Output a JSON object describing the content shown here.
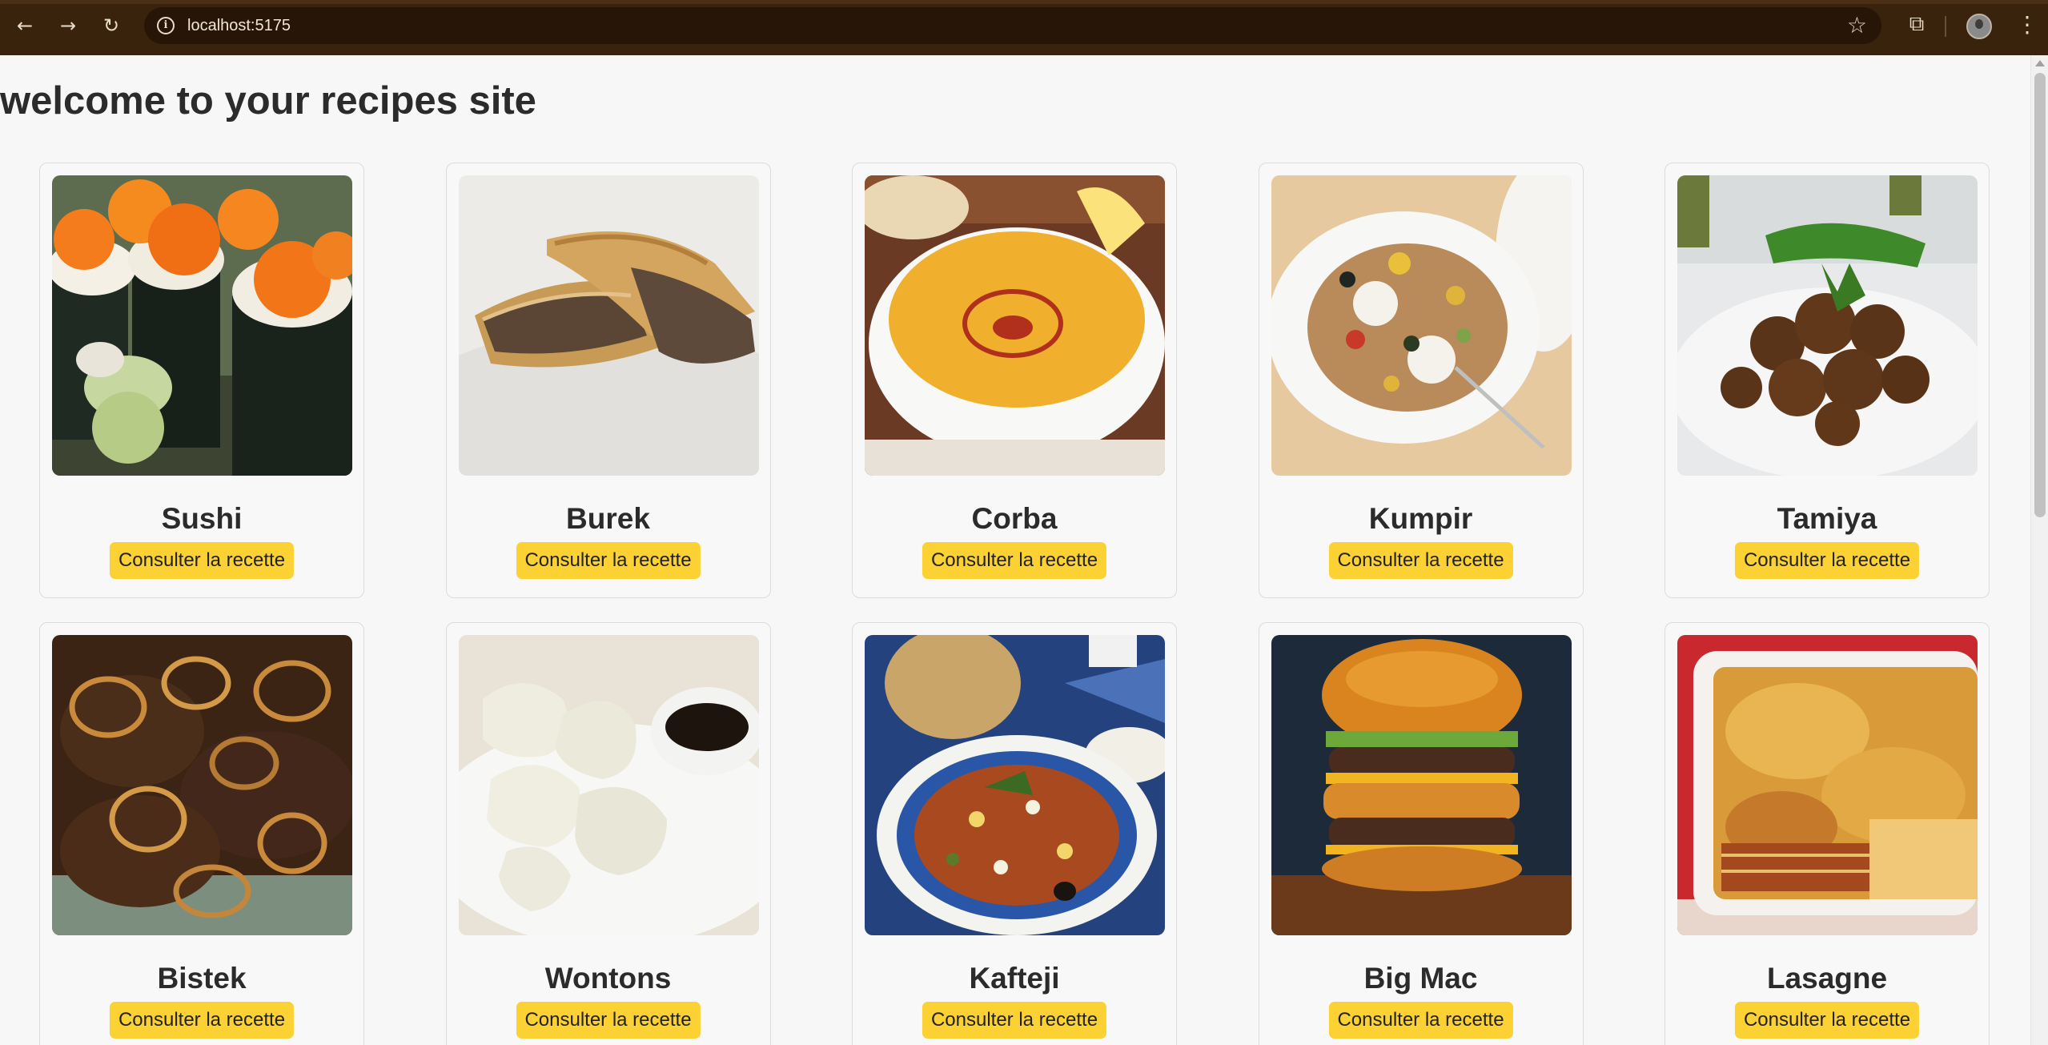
{
  "browser": {
    "url": "localhost:5175"
  },
  "page": {
    "title": "welcome to your recipes site"
  },
  "recipes": [
    {
      "name": "Sushi",
      "button": "Consulter la recette",
      "photo": "sushi-photo"
    },
    {
      "name": "Burek",
      "button": "Consulter la recette",
      "photo": "burek-photo"
    },
    {
      "name": "Corba",
      "button": "Consulter la recette",
      "photo": "corba-photo"
    },
    {
      "name": "Kumpir",
      "button": "Consulter la recette",
      "photo": "kumpir-photo"
    },
    {
      "name": "Tamiya",
      "button": "Consulter la recette",
      "photo": "tamiya-photo"
    },
    {
      "name": "Bistek",
      "button": "Consulter la recette",
      "photo": "bistek-photo"
    },
    {
      "name": "Wontons",
      "button": "Consulter la recette",
      "photo": "wontons-photo"
    },
    {
      "name": "Kafteji",
      "button": "Consulter la recette",
      "photo": "kafteji-photo"
    },
    {
      "name": "Big Mac",
      "button": "Consulter la recette",
      "photo": "big-mac-photo"
    },
    {
      "name": "Lasagne",
      "button": "Consulter la recette",
      "photo": "lasagne-photo"
    }
  ],
  "colors": {
    "accent": "#fbd133",
    "chrome": "#3a230c"
  }
}
